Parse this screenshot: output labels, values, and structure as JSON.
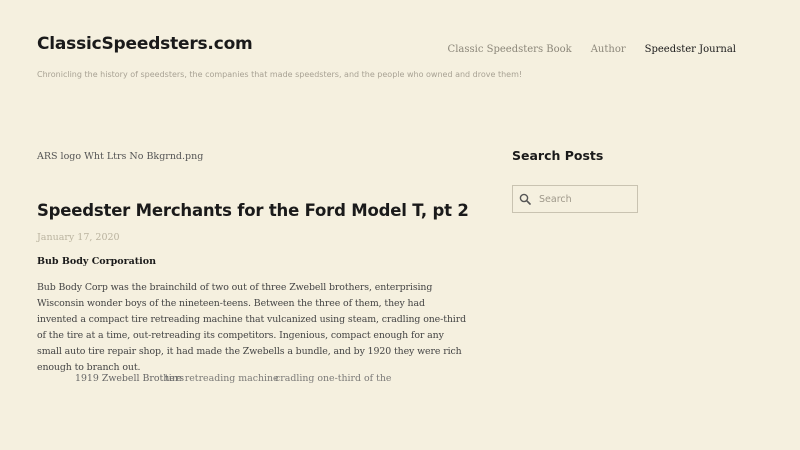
{
  "header": {
    "site_title": "ClassicSpeedsters.com",
    "tagline": "Chronicling the history of speedsters, the companies that made speedsters, and the people who owned and drove them!"
  },
  "nav": {
    "items": [
      {
        "label": "Classic Speedsters Book",
        "current": false
      },
      {
        "label": "Author",
        "current": false
      },
      {
        "label": "Speedster Journal",
        "current": true
      }
    ]
  },
  "main": {
    "broken_image_alt": "ARS logo Wht Ltrs No Bkgrnd.png",
    "post": {
      "title": "Speedster Merchants for the Ford Model T, pt 2",
      "date": "January 17, 2020",
      "subhead": "Bub Body Corporation",
      "body": "Bub Body Corp was the brainchild of two out of three Zwebell brothers, enterprising Wisconsin wonder boys of the nineteen-teens. Between the three of them, they had invented a compact tire retreading machine that vulcanized using steam, cradling one-third of the tire at a time, out-retreading its competitors. Ingenious, compact enough for any small auto tire repair shop, it had made the Zwebells a bundle, and by 1920 they were rich enough to branch out.",
      "caption_fragments": [
        "1919 Zwebell Brothers",
        "tire retreading machine",
        "cradling one-third of the"
      ]
    }
  },
  "sidebar": {
    "widget_title": "Search Posts",
    "search_placeholder": "Search"
  },
  "colors": {
    "background": "#f5f0df",
    "nav_muted": "#8c877a",
    "date": "#bab39f"
  }
}
